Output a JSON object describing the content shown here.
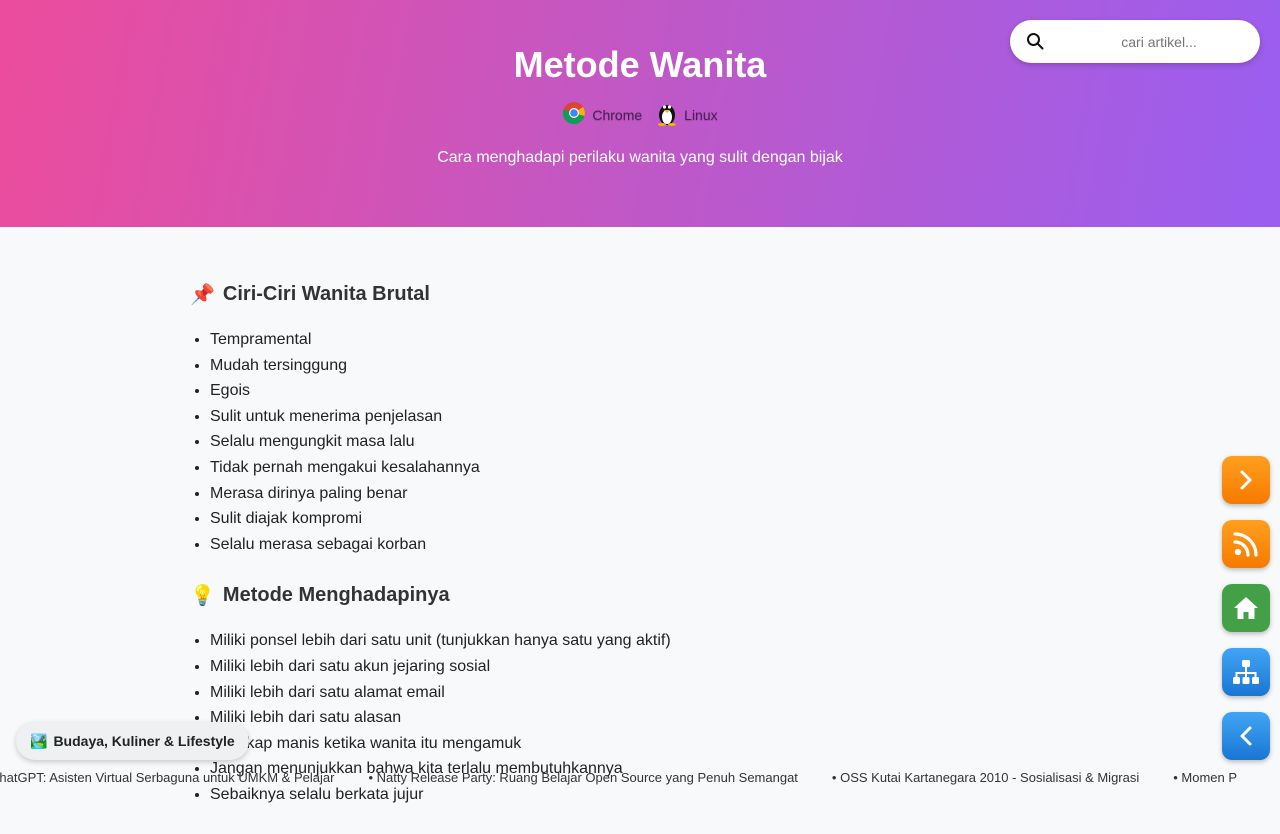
{
  "header": {
    "title": "Metode Wanita",
    "badges": [
      {
        "label": "Chrome",
        "icon": "chrome-icon"
      },
      {
        "label": "Linux",
        "icon": "tux-icon"
      }
    ],
    "subtitle": "Cara menghadapi perilaku wanita yang sulit dengan bijak"
  },
  "search": {
    "placeholder": "cari artikel...",
    "value": "",
    "icon": "search-icon"
  },
  "sections": [
    {
      "emoji": "📌",
      "title": "Ciri-Ciri Wanita Brutal",
      "items": [
        "Tempramental",
        "Mudah tersinggung",
        "Egois",
        "Sulit untuk menerima penjelasan",
        "Selalu mengungkit masa lalu",
        "Tidak pernah mengakui kesalahannya",
        "Merasa dirinya paling benar",
        "Sulit diajak kompromi",
        "Selalu merasa sebagai korban"
      ]
    },
    {
      "emoji": "💡",
      "title": "Metode Menghadapinya",
      "items": [
        "Miliki ponsel lebih dari satu unit (tunjukkan hanya satu yang aktif)",
        "Miliki lebih dari satu akun jejaring sosial",
        "Miliki lebih dari satu alamat email",
        "Miliki lebih dari satu alasan",
        "Bersikap manis ketika wanita itu mengamuk",
        "Jangan menunjukkan bahwa kita terlalu membutuhkannya",
        "Sebaiknya selalu berkata jujur"
      ]
    }
  ],
  "fab_buttons": [
    {
      "icon": "chevron-right-icon",
      "color": "#f57b00"
    },
    {
      "icon": "rss-icon",
      "color": "#f57b00"
    },
    {
      "icon": "home-icon",
      "color": "#43a047"
    },
    {
      "icon": "sitemap-icon",
      "color": "#1976d2"
    },
    {
      "icon": "chevron-left-icon",
      "color": "#1976d2"
    }
  ],
  "category_badge": {
    "emoji": "🏞️",
    "label": "Budaya, Kuliner & Lifestyle"
  },
  "ticker": [
    "ChatGPT: Asisten Virtual Serbaguna untuk UMKM & Pelajar",
    "Natty Release Party: Ruang Belajar Open Source yang Penuh Semangat",
    "OSS Kutai Kartanegara 2010 - Sosialisasi & Migrasi",
    "Momen P"
  ],
  "colors": {
    "header_start": "#ec4c9c",
    "header_end": "#9a5ef0",
    "orange": "#f57b00",
    "green": "#43a047",
    "blue": "#1976d2"
  }
}
